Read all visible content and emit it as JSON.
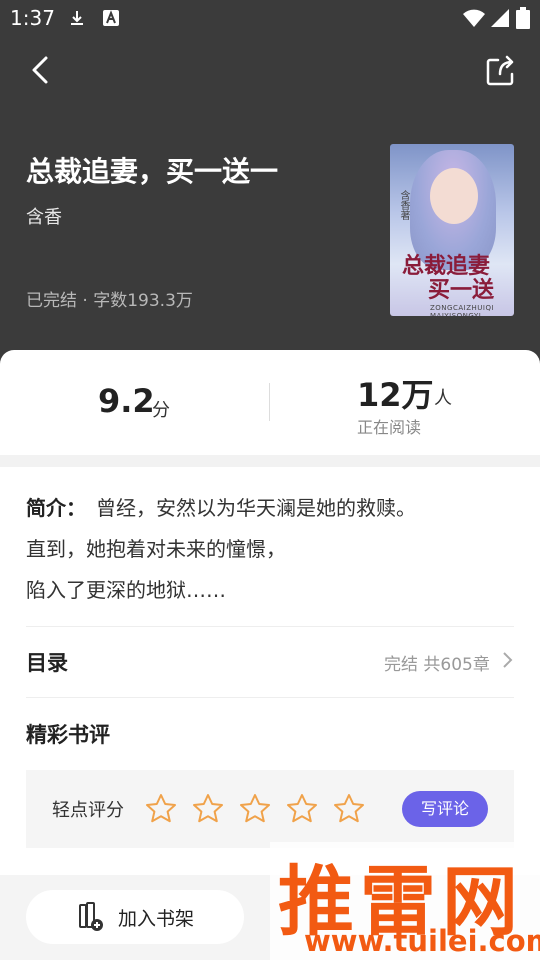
{
  "status_bar": {
    "time": "1:37"
  },
  "book": {
    "title": "总裁追妻，买一送一",
    "author": "含香",
    "meta": "已完结 · 字数193.3万",
    "cover": {
      "title_line1": "总裁追妻",
      "title_line2": "买一送",
      "author_text": "含香著",
      "pinyin": "ZONGCAIZHUIQI MAIYISONGYI"
    }
  },
  "stats": {
    "score": "9.2",
    "score_unit": "分",
    "readers": "12万",
    "readers_unit": "人",
    "readers_label": "正在阅读"
  },
  "intro": {
    "label": "简介：",
    "lines": [
      "曾经，安然以为华天澜是她的救赎。",
      "直到，她抱着对未来的憧憬，",
      "陷入了更深的地狱……"
    ]
  },
  "toc": {
    "label": "目录",
    "status": "完结 共605章"
  },
  "reviews": {
    "label": "精彩书评",
    "rate_label": "轻点评分",
    "star_count": 5,
    "write_button": "写评论"
  },
  "bottom": {
    "add_shelf": "加入书架"
  },
  "watermark": {
    "brand": "推雷网",
    "url": "www.tuilei.com"
  },
  "colors": {
    "header_bg": "#3b3b3b",
    "accent": "#6b63e8",
    "star": "#f0a24a",
    "watermark": "#f25a12"
  }
}
